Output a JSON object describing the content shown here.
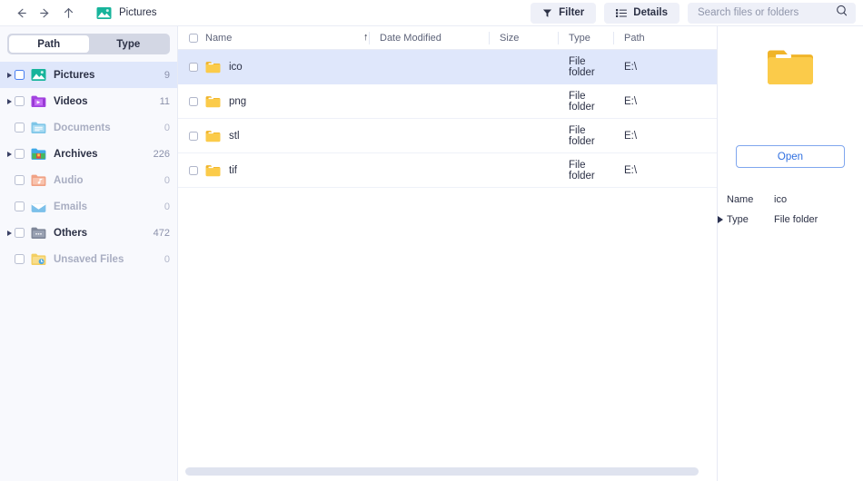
{
  "topbar": {
    "back_icon": "arrow-left-icon",
    "forward_icon": "arrow-right-icon",
    "up_icon": "arrow-up-icon",
    "breadcrumb_icon": "pictures-icon",
    "breadcrumb_label": "Pictures",
    "filter_label": "Filter",
    "filter_icon": "funnel-icon",
    "details_label": "Details",
    "details_icon": "list-details-icon",
    "search_placeholder": "Search files or folders",
    "search_value": "",
    "search_icon": "magnifier-icon"
  },
  "sidebar": {
    "tabs": [
      {
        "label": "Path",
        "active": true
      },
      {
        "label": "Type",
        "active": false
      }
    ],
    "items": [
      {
        "label": "Pictures",
        "count": "9",
        "icon": "pictures-icon",
        "expandable": true,
        "selected": true,
        "dim": false,
        "checkbox_focus": true
      },
      {
        "label": "Videos",
        "count": "11",
        "icon": "videos-icon",
        "expandable": true,
        "selected": false,
        "dim": false,
        "checkbox_focus": false
      },
      {
        "label": "Documents",
        "count": "0",
        "icon": "documents-icon",
        "expandable": false,
        "selected": false,
        "dim": true,
        "checkbox_focus": false
      },
      {
        "label": "Archives",
        "count": "226",
        "icon": "archives-icon",
        "expandable": true,
        "selected": false,
        "dim": false,
        "checkbox_focus": false
      },
      {
        "label": "Audio",
        "count": "0",
        "icon": "audio-icon",
        "expandable": false,
        "selected": false,
        "dim": true,
        "checkbox_focus": false
      },
      {
        "label": "Emails",
        "count": "0",
        "icon": "emails-icon",
        "expandable": false,
        "selected": false,
        "dim": true,
        "checkbox_focus": false
      },
      {
        "label": "Others",
        "count": "472",
        "icon": "others-icon",
        "expandable": true,
        "selected": false,
        "dim": false,
        "checkbox_focus": false
      },
      {
        "label": "Unsaved Files",
        "count": "0",
        "icon": "unsaved-files-icon",
        "expandable": false,
        "selected": false,
        "dim": true,
        "checkbox_focus": false
      }
    ]
  },
  "filelist": {
    "columns": {
      "name": "Name",
      "date_modified": "Date Modified",
      "size": "Size",
      "type": "Type",
      "path": "Path"
    },
    "sort_indicator": "↑",
    "sort_column": "Date Modified",
    "rows": [
      {
        "name": "ico",
        "date_modified": "",
        "size": "",
        "type": "File folder",
        "path": "E:\\",
        "icon": "folder-icon",
        "selected": true
      },
      {
        "name": "png",
        "date_modified": "",
        "size": "",
        "type": "File folder",
        "path": "E:\\",
        "icon": "folder-icon",
        "selected": false
      },
      {
        "name": "stl",
        "date_modified": "",
        "size": "",
        "type": "File folder",
        "path": "E:\\",
        "icon": "folder-icon",
        "selected": false
      },
      {
        "name": "tif",
        "date_modified": "",
        "size": "",
        "type": "File folder",
        "path": "E:\\",
        "icon": "folder-icon",
        "selected": false
      }
    ]
  },
  "preview": {
    "icon": "folder-large-icon",
    "open_label": "Open",
    "details": [
      {
        "key": "Name",
        "value": "ico",
        "caret": false
      },
      {
        "key": "Type",
        "value": "File folder",
        "caret": true
      }
    ]
  },
  "colors": {
    "accent": "#2f6fe0",
    "selection": "#dfe7fb",
    "sidebar_bg": "#f8f9fd",
    "chip_bg": "#eef0f8",
    "folder_yellow": "#f9c846",
    "text": "#2c3146",
    "muted": "#8b91ab"
  }
}
